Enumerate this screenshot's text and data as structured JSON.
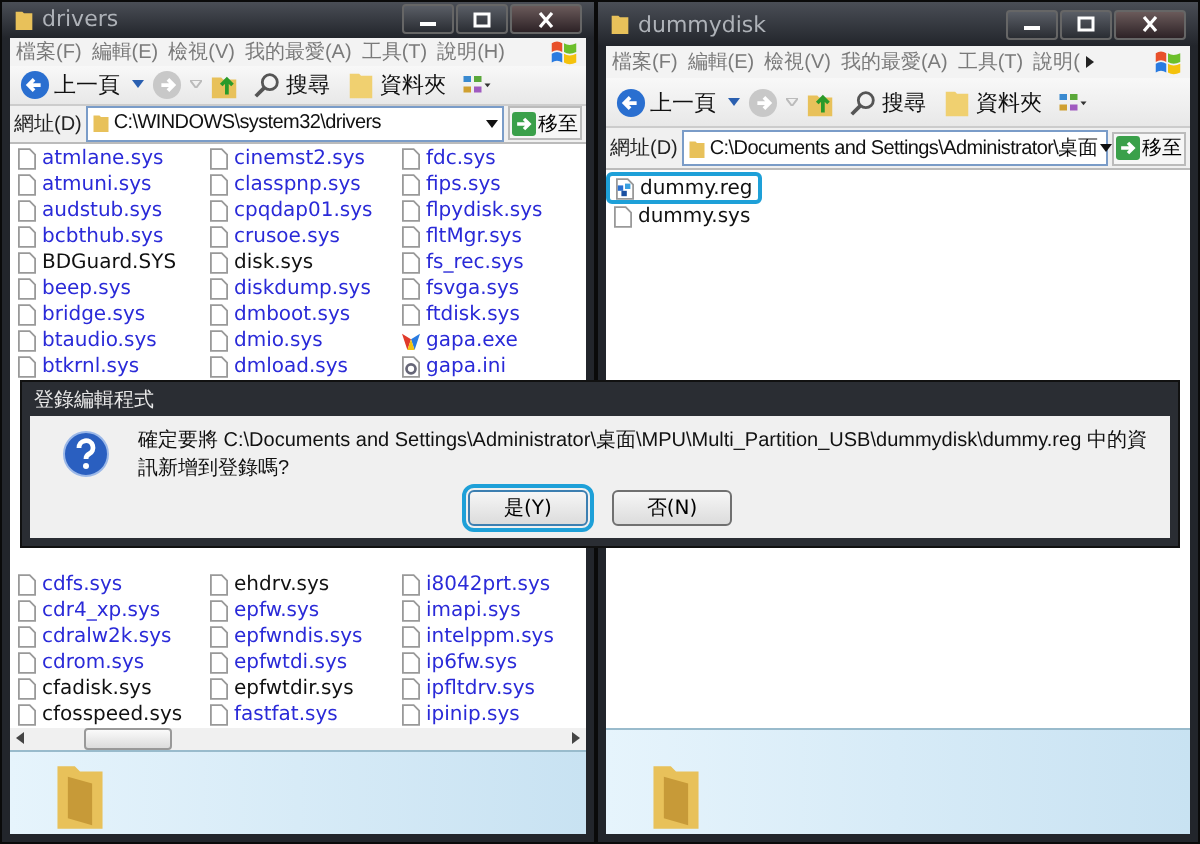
{
  "windows": [
    {
      "title": "drivers",
      "menu": [
        "檔案(F)",
        "編輯(E)",
        "檢視(V)",
        "我的最愛(A)",
        "工具(T)",
        "說明(H)"
      ],
      "menu_overflow": false,
      "toolbar": {
        "back": "上一頁",
        "search": "搜尋",
        "folders": "資料夾"
      },
      "address": {
        "label": "網址(D)",
        "path": "C:\\WINDOWS\\system32\\drivers",
        "go": "移至"
      },
      "file_groups": [
        {
          "columns": [
            [
              {
                "name": "atmlane.sys",
                "kind": "file",
                "compressed": true,
                "selected": false
              },
              {
                "name": "atmuni.sys",
                "kind": "file",
                "compressed": true,
                "selected": false
              },
              {
                "name": "audstub.sys",
                "kind": "file",
                "compressed": true,
                "selected": false
              },
              {
                "name": "bcbthub.sys",
                "kind": "file",
                "compressed": true,
                "selected": false
              },
              {
                "name": "BDGuard.SYS",
                "kind": "file",
                "compressed": false,
                "selected": false
              },
              {
                "name": "beep.sys",
                "kind": "file",
                "compressed": true,
                "selected": false
              },
              {
                "name": "bridge.sys",
                "kind": "file",
                "compressed": true,
                "selected": false
              },
              {
                "name": "btaudio.sys",
                "kind": "file",
                "compressed": true,
                "selected": false
              },
              {
                "name": "btkrnl.sys",
                "kind": "file",
                "compressed": true,
                "selected": false
              }
            ],
            [
              {
                "name": "cinemst2.sys",
                "kind": "file",
                "compressed": true,
                "selected": false
              },
              {
                "name": "classpnp.sys",
                "kind": "file",
                "compressed": true,
                "selected": false
              },
              {
                "name": "cpqdap01.sys",
                "kind": "file",
                "compressed": true,
                "selected": false
              },
              {
                "name": "crusoe.sys",
                "kind": "file",
                "compressed": true,
                "selected": false
              },
              {
                "name": "disk.sys",
                "kind": "file",
                "compressed": false,
                "selected": false
              },
              {
                "name": "diskdump.sys",
                "kind": "file",
                "compressed": true,
                "selected": false
              },
              {
                "name": "dmboot.sys",
                "kind": "file",
                "compressed": true,
                "selected": false
              },
              {
                "name": "dmio.sys",
                "kind": "file",
                "compressed": true,
                "selected": false
              },
              {
                "name": "dmload.sys",
                "kind": "file",
                "compressed": true,
                "selected": false
              }
            ],
            [
              {
                "name": "fdc.sys",
                "kind": "file",
                "compressed": true,
                "selected": false
              },
              {
                "name": "fips.sys",
                "kind": "file",
                "compressed": true,
                "selected": false
              },
              {
                "name": "flpydisk.sys",
                "kind": "file",
                "compressed": true,
                "selected": false
              },
              {
                "name": "fltMgr.sys",
                "kind": "file",
                "compressed": true,
                "selected": false
              },
              {
                "name": "fs_rec.sys",
                "kind": "file",
                "compressed": true,
                "selected": false
              },
              {
                "name": "fsvga.sys",
                "kind": "file",
                "compressed": true,
                "selected": false
              },
              {
                "name": "ftdisk.sys",
                "kind": "file",
                "compressed": true,
                "selected": false
              },
              {
                "name": "gapa.exe",
                "kind": "exe",
                "compressed": true,
                "selected": false
              },
              {
                "name": "gapa.ini",
                "kind": "ini",
                "compressed": true,
                "selected": false
              }
            ]
          ]
        },
        {
          "columns": [
            [
              {
                "name": "cdfs.sys",
                "kind": "file",
                "compressed": true,
                "selected": false
              },
              {
                "name": "cdr4_xp.sys",
                "kind": "file",
                "compressed": true,
                "selected": false
              },
              {
                "name": "cdralw2k.sys",
                "kind": "file",
                "compressed": true,
                "selected": false
              },
              {
                "name": "cdrom.sys",
                "kind": "file",
                "compressed": true,
                "selected": false
              },
              {
                "name": "cfadisk.sys",
                "kind": "file",
                "compressed": false,
                "selected": false
              },
              {
                "name": "cfosspeed.sys",
                "kind": "file",
                "compressed": false,
                "selected": false
              }
            ],
            [
              {
                "name": "ehdrv.sys",
                "kind": "file",
                "compressed": false,
                "selected": false
              },
              {
                "name": "epfw.sys",
                "kind": "file",
                "compressed": true,
                "selected": false
              },
              {
                "name": "epfwndis.sys",
                "kind": "file",
                "compressed": true,
                "selected": false
              },
              {
                "name": "epfwtdi.sys",
                "kind": "file",
                "compressed": true,
                "selected": false
              },
              {
                "name": "epfwtdir.sys",
                "kind": "file",
                "compressed": false,
                "selected": false
              },
              {
                "name": "fastfat.sys",
                "kind": "file",
                "compressed": true,
                "selected": false
              }
            ],
            [
              {
                "name": "i8042prt.sys",
                "kind": "file",
                "compressed": true,
                "selected": false
              },
              {
                "name": "imapi.sys",
                "kind": "file",
                "compressed": true,
                "selected": false
              },
              {
                "name": "intelppm.sys",
                "kind": "file",
                "compressed": true,
                "selected": false
              },
              {
                "name": "ip6fw.sys",
                "kind": "file",
                "compressed": true,
                "selected": false
              },
              {
                "name": "ipfltdrv.sys",
                "kind": "file",
                "compressed": true,
                "selected": false
              },
              {
                "name": "ipinip.sys",
                "kind": "file",
                "compressed": true,
                "selected": false
              }
            ]
          ]
        }
      ],
      "horizontal_scrollbar": true
    },
    {
      "title": "dummydisk",
      "menu": [
        "檔案(F)",
        "編輯(E)",
        "檢視(V)",
        "我的最愛(A)",
        "工具(T)",
        "說明("
      ],
      "menu_overflow": true,
      "toolbar": {
        "back": "上一頁",
        "search": "搜尋",
        "folders": "資料夾"
      },
      "address": {
        "label": "網址(D)",
        "path": "C:\\Documents and Settings\\Administrator\\桌面",
        "go": "移至"
      },
      "file_groups": [
        {
          "columns": [
            [
              {
                "name": "dummy.reg",
                "kind": "reg",
                "compressed": false,
                "selected": true
              },
              {
                "name": "dummy.sys",
                "kind": "file",
                "compressed": false,
                "selected": false
              }
            ]
          ]
        }
      ],
      "horizontal_scrollbar": false
    }
  ],
  "dialog": {
    "title": "登錄編輯程式",
    "message": "確定要將 C:\\Documents and Settings\\Administrator\\桌面\\MPU\\Multi_Partition_USB\\dummydisk\\dummy.reg 中的資訊新增到登錄嗎?",
    "buttons": [
      {
        "label": "是(Y)",
        "selected": true
      },
      {
        "label": "否(N)",
        "selected": false
      }
    ]
  }
}
